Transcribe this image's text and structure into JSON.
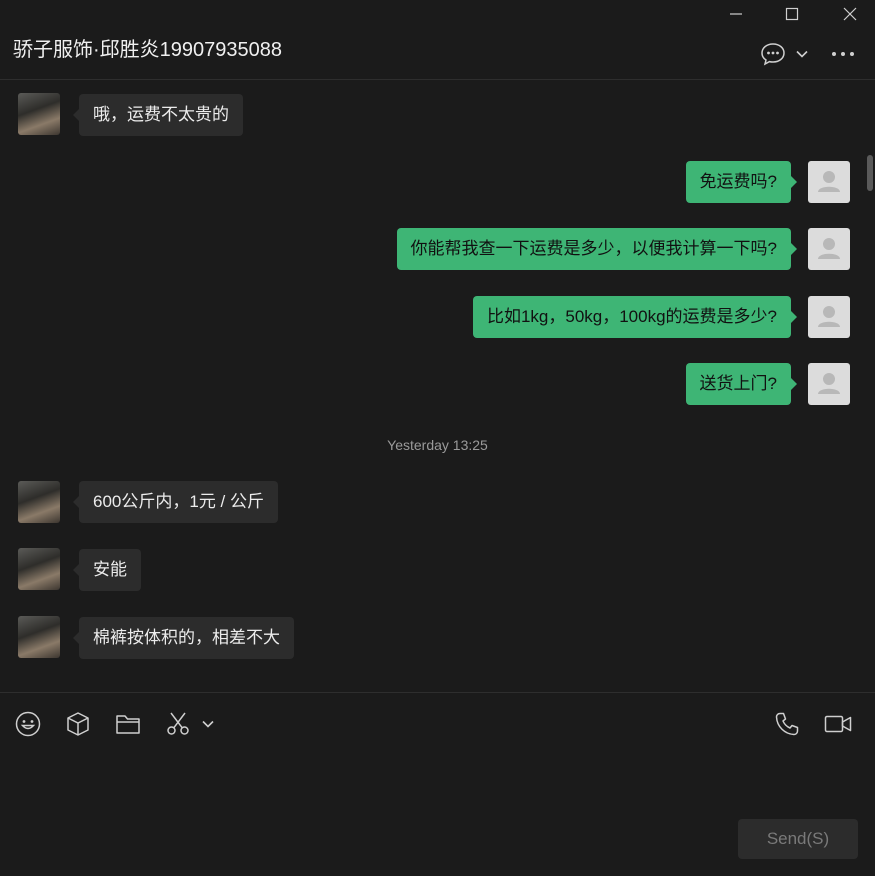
{
  "header": {
    "title": "骄子服饰·邱胜炎19907935088"
  },
  "icons": {
    "minimize": "minimize-icon",
    "maximize": "maximize-icon",
    "close": "close-icon",
    "chat": "chat-bubble-icon",
    "dropdown": "chevron-down-icon",
    "more": "more-icon",
    "emoji": "emoji-icon",
    "sticker": "cube-icon",
    "folder": "folder-icon",
    "scissors": "scissors-icon",
    "phone": "phone-icon",
    "video": "video-icon"
  },
  "messages": [
    {
      "side": "peer",
      "text": "哦，运费不太贵的"
    },
    {
      "side": "self",
      "text": "免运费吗?"
    },
    {
      "side": "self",
      "text": "你能帮我查一下运费是多少，以便我计算一下吗?"
    },
    {
      "side": "self",
      "text": "比如1kg，50kg，100kg的运费是多少?"
    },
    {
      "side": "self",
      "text": "送货上门?"
    },
    {
      "side": "time",
      "text": "Yesterday 13:25"
    },
    {
      "side": "peer",
      "text": "600公斤内，1元 / 公斤"
    },
    {
      "side": "peer",
      "text": "安能"
    },
    {
      "side": "peer",
      "text": "棉裤按体积的，相差不大"
    }
  ],
  "composer": {
    "value": "",
    "send_label": "Send(S)"
  },
  "colors": {
    "background": "#1b1b1b",
    "self_bubble": "#3eb575",
    "peer_bubble": "#2c2c2c"
  }
}
